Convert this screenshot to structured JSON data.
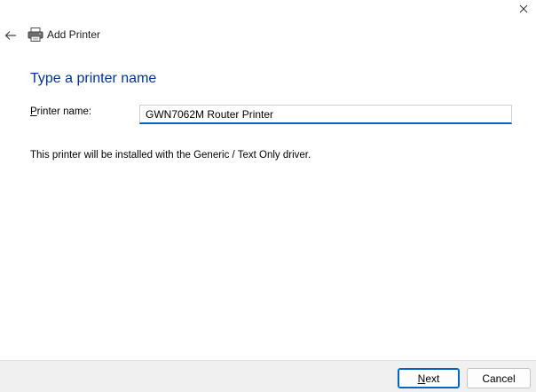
{
  "window": {
    "close_glyph": "✕"
  },
  "header": {
    "back_icon": "back-arrow-icon",
    "printer_icon": "printer-icon",
    "title": "Add Printer"
  },
  "main": {
    "heading": "Type a printer name",
    "printer_name_label_mnemonic": "P",
    "printer_name_label_rest": "rinter name:",
    "printer_name_value": "GWN7062M Router Printer",
    "driver_info": "This printer will be installed with the Generic / Text Only driver."
  },
  "footer": {
    "next_mnemonic": "N",
    "next_rest": "ext",
    "cancel_label": "Cancel"
  },
  "colors": {
    "heading": "#003399",
    "accent": "#0067c0",
    "footer_bg": "#f0f0f0"
  }
}
